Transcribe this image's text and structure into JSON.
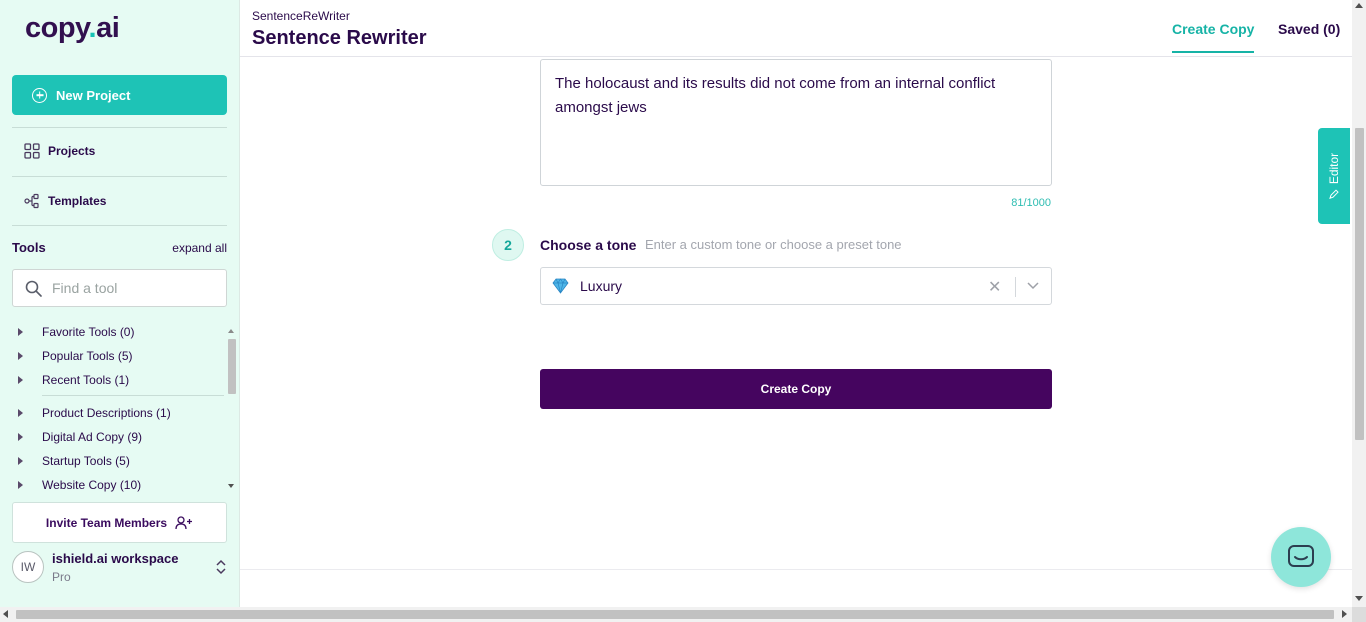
{
  "logo": {
    "text_main": "copy",
    "text_dot": ".",
    "text_tail": "ai"
  },
  "sidebar": {
    "new_project_label": "New Project",
    "nav": [
      {
        "label": "Projects",
        "icon": "grid-icon"
      },
      {
        "label": "Templates",
        "icon": "templates-icon"
      }
    ],
    "tools_title": "Tools",
    "expand_all_label": "expand all",
    "search": {
      "placeholder": "Find a tool",
      "value": ""
    },
    "tool_groups": [
      "Favorite Tools (0)",
      "Popular Tools (5)",
      "Recent Tools (1)",
      "Product Descriptions (1)",
      "Digital Ad Copy (9)",
      "Startup Tools (5)",
      "Website Copy (10)"
    ],
    "invite_label": "Invite Team Members",
    "workspace": {
      "initials": "IW",
      "name": "ishield.ai workspace",
      "plan": "Pro"
    }
  },
  "header": {
    "breadcrumb": "SentenceReWriter",
    "title": "Sentence Rewriter",
    "tabs": [
      {
        "label": "Create Copy",
        "active": true
      },
      {
        "label": "Saved (0)",
        "active": false
      }
    ]
  },
  "main": {
    "input_text": "The holocaust and its results did not come from an internal conflict amongst jews",
    "char_counter": "81/1000",
    "step_number": "2",
    "tone_label": "Choose a tone",
    "tone_hint": "Enter a custom tone or choose a preset tone",
    "tone_value": "Luxury",
    "tone_icon": "gem-icon",
    "create_button_label": "Create Copy"
  },
  "editor_tab_label": "Editor",
  "colors": {
    "accent_teal": "#1ec3b6",
    "brand_purple": "#45055f",
    "sidebar_bg": "#e6fbf3",
    "text_dark": "#2a0a4a"
  }
}
